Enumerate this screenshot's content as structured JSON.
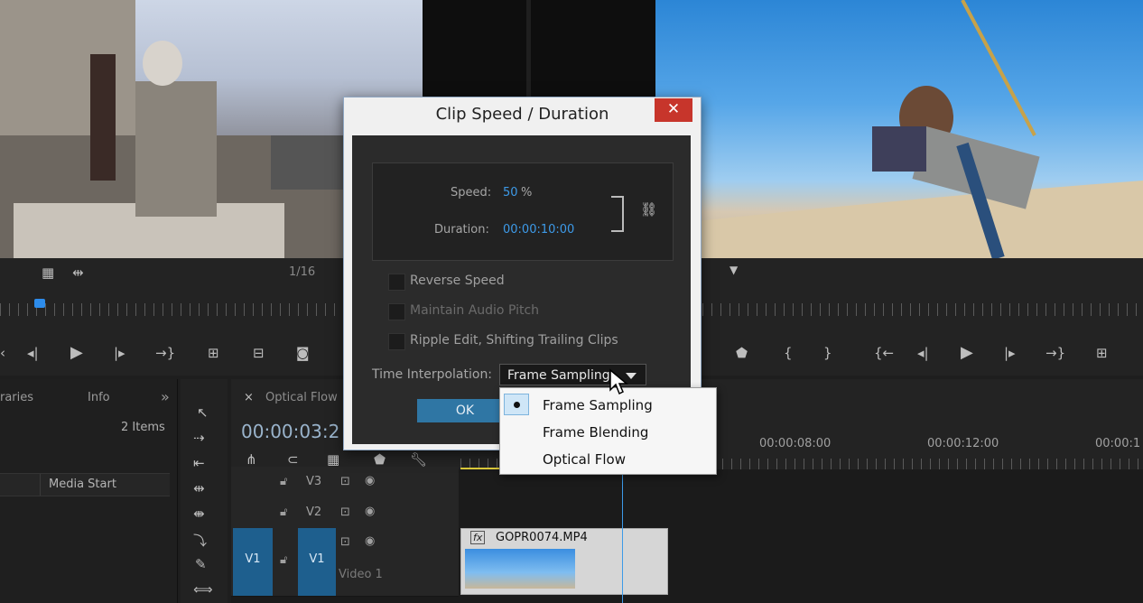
{
  "program_monitor": {
    "page_count": "1/16"
  },
  "project_panel": {
    "tab_libraries": "raries",
    "tab_info": "Info",
    "overflow_symbol": "»",
    "item_count": "2 Items",
    "column_media_start": "Media Start"
  },
  "timeline": {
    "tab_close": "×",
    "sequence_name": "Optical Flow",
    "current_timecode": "00:00:03:2",
    "ruler_labels": [
      "00:00:08:00",
      "00:00:12:00",
      "00:00:1"
    ],
    "tracks": [
      {
        "id": "V3",
        "label": "V3"
      },
      {
        "id": "V2",
        "label": "V2"
      },
      {
        "id": "V1",
        "label": "V1",
        "source": "V1",
        "name": "Video 1"
      }
    ],
    "clip": {
      "fx_label": "fx",
      "name": "GOPR0074.MP4"
    }
  },
  "dialog": {
    "title": "Clip Speed / Duration",
    "close_symbol": "✕",
    "speed_label": "Speed:",
    "speed_value": "50",
    "speed_unit": "%",
    "duration_label": "Duration:",
    "duration_value": "00:00:10:00",
    "checkboxes": [
      {
        "label": "Reverse Speed",
        "checked": false
      },
      {
        "label": "Maintain Audio Pitch",
        "checked": false
      },
      {
        "label": "Ripple Edit, Shifting Trailing Clips",
        "checked": false
      }
    ],
    "interpolation_label": "Time Interpolation:",
    "interpolation_selected": "Frame Sampling",
    "ok_label": "OK"
  },
  "interpolation_options": [
    {
      "label": "Frame Sampling",
      "selected": true
    },
    {
      "label": "Frame Blending",
      "selected": false
    },
    {
      "label": "Optical Flow",
      "selected": false
    }
  ],
  "colors": {
    "accent_blue": "#3d9ae8",
    "close_red": "#c7352b",
    "ok_blue": "#2f76a4"
  }
}
